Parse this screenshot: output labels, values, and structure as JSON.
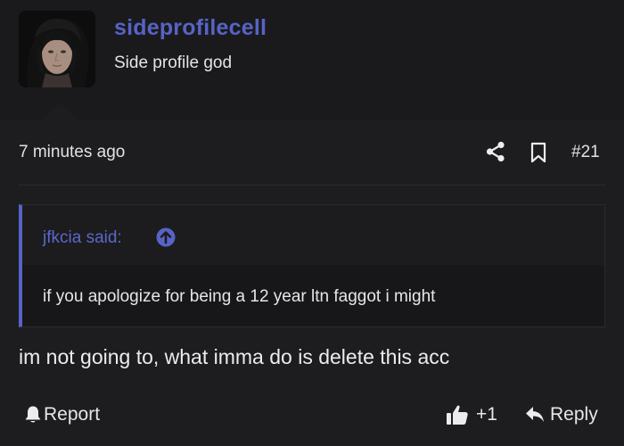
{
  "author": {
    "username": "sideprofilecell",
    "user_title": "Side profile god",
    "avatar": "avatar-portrait"
  },
  "post": {
    "timestamp": "7 minutes ago",
    "number": "#21",
    "share_icon": "share-icon",
    "bookmark_icon": "bookmark-icon"
  },
  "quote": {
    "author_label": "jfkcia said:",
    "text": "if you apologize for being a 12 year ltn faggot i might",
    "jump_icon": "arrow-up-circle-icon"
  },
  "message": "im not going to, what imma do is delete this acc",
  "actions": {
    "report_label": "Report",
    "reaction_count": "+1",
    "reply_label": "Reply"
  },
  "colors": {
    "accent": "#5763c6",
    "background": "#1d1d1f",
    "text": "#e8e8ea"
  }
}
